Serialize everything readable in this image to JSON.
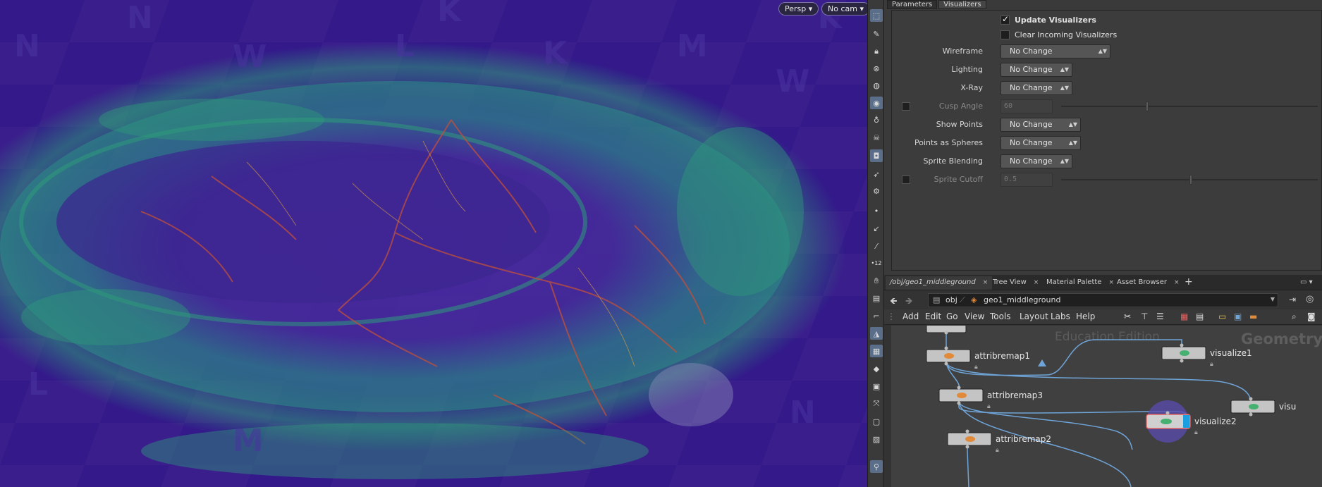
{
  "viewport": {
    "persp_label": "Persp",
    "cam_label": "No cam",
    "grid_letters": [
      "N",
      "W",
      "L",
      "K",
      "M",
      "N",
      "K",
      "W",
      "L",
      "M",
      "N",
      "K"
    ]
  },
  "params": {
    "tabs": [
      "Parameters",
      "Visualizers"
    ],
    "update_visualizers": "Update Visualizers",
    "clear_incoming": "Clear Incoming Visualizers",
    "rows": {
      "wireframe": {
        "label": "Wireframe",
        "value": "No Change"
      },
      "lighting": {
        "label": "Lighting",
        "value": "No Change"
      },
      "xray": {
        "label": "X-Ray",
        "value": "No Change"
      },
      "cusp": {
        "label": "Cusp Angle",
        "value": "60"
      },
      "show_points": {
        "label": "Show Points",
        "value": "No Change"
      },
      "points_spheres": {
        "label": "Points as Spheres",
        "value": "No Change"
      },
      "sprite_blending": {
        "label": "Sprite Blending",
        "value": "No Change"
      },
      "sprite_cutoff": {
        "label": "Sprite Cutoff",
        "value": "0.5"
      }
    }
  },
  "network": {
    "tabs": [
      {
        "label": "/obj/geo1_middleground"
      },
      {
        "label": "Tree View"
      },
      {
        "label": "Material Palette"
      },
      {
        "label": "Asset Browser"
      }
    ],
    "path": [
      "obj",
      "geo1_middleground"
    ],
    "menu": [
      "Add",
      "Edit",
      "Go",
      "View",
      "Tools",
      "Layout",
      "Labs",
      "Help"
    ],
    "watermark": "Education Edition",
    "context": "Geometry",
    "nodes": {
      "attribremap1": "attribremap1",
      "attribremap3": "attribremap3",
      "attribremap2": "attribremap2",
      "visualize1": "visualize1",
      "visualize2": "visualize2",
      "visualize3": "visu"
    }
  },
  "colors": {
    "viewport_bg": "#3a1f8c",
    "terrain_green": "#2e9a7a",
    "terrain_red": "#c0503a",
    "selection_blue": "#6fa4d8"
  }
}
